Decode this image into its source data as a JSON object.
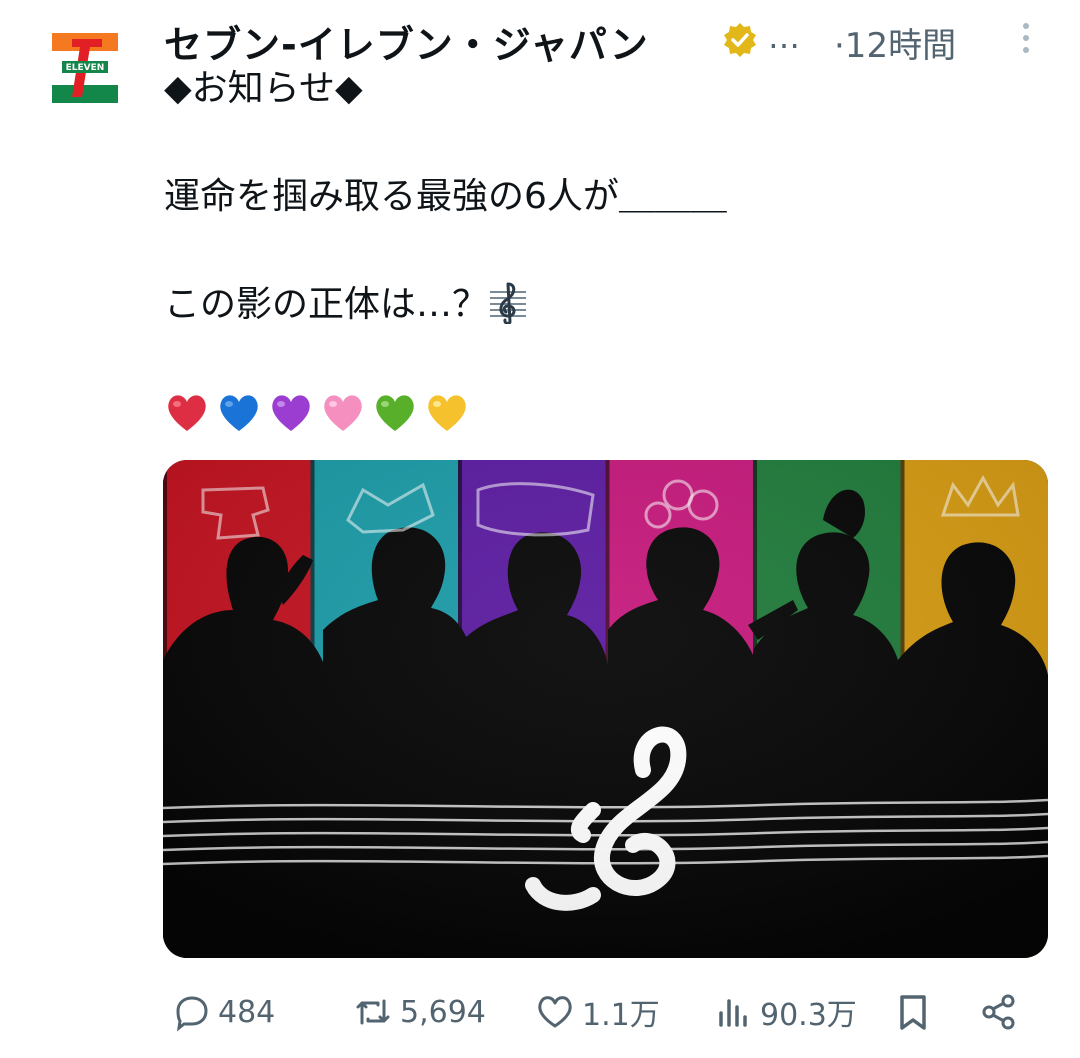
{
  "account": {
    "display_name": "セブン‐イレブン・ジャパン",
    "handle_ellipsis": "…",
    "timestamp": "·12時間",
    "avatar_icon": "seven-eleven-logo"
  },
  "tweet": {
    "line1": "◆お知らせ◆",
    "line2": "運命を掴み取る最強の6人が＿＿＿",
    "line3": "この影の正体は…？",
    "hearts": [
      "red-heart",
      "blue-heart",
      "purple-heart",
      "pink-heart",
      "green-heart",
      "yellow-heart"
    ]
  },
  "media": {
    "panel_colors": [
      "#c1121f",
      "#1a9aa6",
      "#5a1aa0",
      "#c4187a",
      "#1f7a3a",
      "#d49a12"
    ]
  },
  "actions": {
    "replies": "484",
    "reposts": "5,694",
    "likes": "1.1万",
    "views": "90.3万"
  },
  "colors": {
    "text": "#0f1419",
    "secondary": "#536471",
    "verified_gold": "#e2b719"
  }
}
